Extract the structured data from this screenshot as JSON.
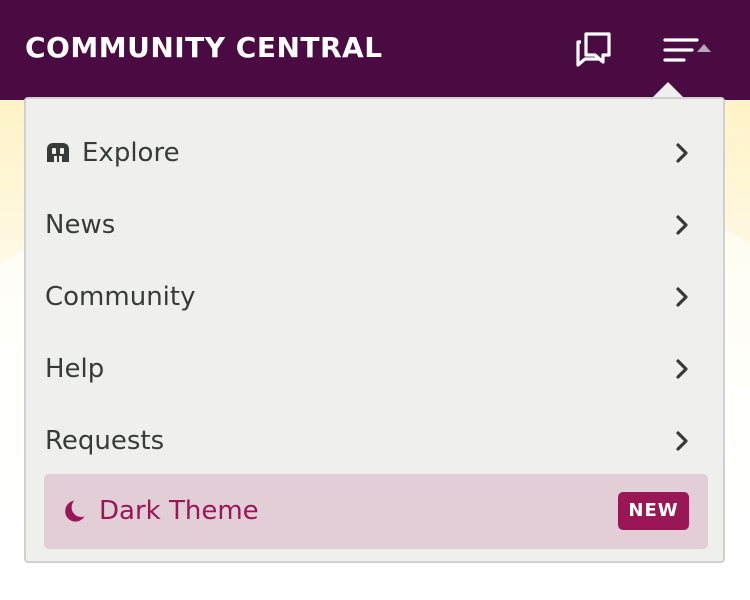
{
  "header": {
    "title": "COMMUNITY CENTRAL",
    "icons": {
      "discussions": "discussions-icon",
      "menu": "menu-icon",
      "caret": "caret-up-icon"
    },
    "colors": {
      "background": "#4a0b43",
      "text": "#ffffff"
    }
  },
  "menu": {
    "items": [
      {
        "label": "Explore",
        "icon": "explore-icon",
        "chevron": "chevron-right-icon"
      },
      {
        "label": "News",
        "chevron": "chevron-right-icon"
      },
      {
        "label": "Community",
        "chevron": "chevron-right-icon"
      },
      {
        "label": "Help",
        "chevron": "chevron-right-icon"
      },
      {
        "label": "Requests",
        "chevron": "chevron-right-icon"
      }
    ],
    "dark_theme": {
      "label": "Dark Theme",
      "badge": "NEW",
      "icon": "moon-icon",
      "colors": {
        "background": "#e1ced7",
        "accent": "#9a1756"
      }
    },
    "colors": {
      "background": "#eff0ed",
      "text": "#393b3a"
    }
  }
}
